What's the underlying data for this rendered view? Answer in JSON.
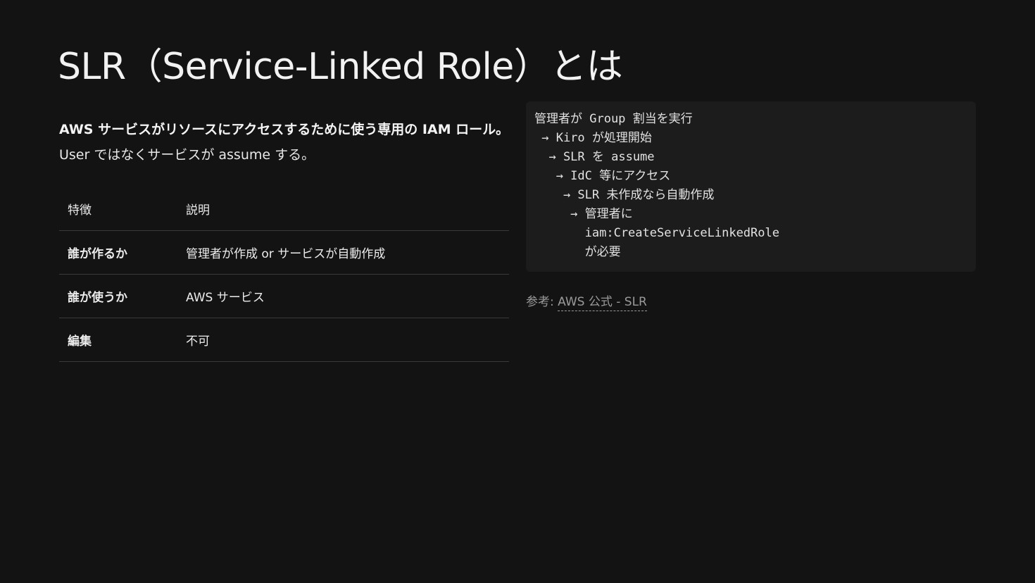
{
  "slide": {
    "title": "SLR（Service-Linked Role）とは"
  },
  "lead": {
    "bold": "AWS サービスがリソースにアクセスするために使う専用の IAM ロール。",
    "normal": " User ではなくサービスが assume する。"
  },
  "table": {
    "headers": [
      "特徴",
      "説明"
    ],
    "rows": [
      [
        "誰が作るか",
        "管理者が作成 or サービスが自動作成"
      ],
      [
        "誰が使うか",
        "AWS サービス"
      ],
      [
        "編集",
        "不可"
      ]
    ]
  },
  "code": {
    "text": "管理者が Group 割当を実行\n → Kiro が処理開始\n  → SLR を assume\n   → IdC 等にアクセス\n    → SLR 未作成なら自動作成\n     → 管理者に\n       iam:CreateServiceLinkedRole\n       が必要"
  },
  "reference": {
    "prefix": "参考: ",
    "link_text": "AWS 公式 - SLR"
  }
}
